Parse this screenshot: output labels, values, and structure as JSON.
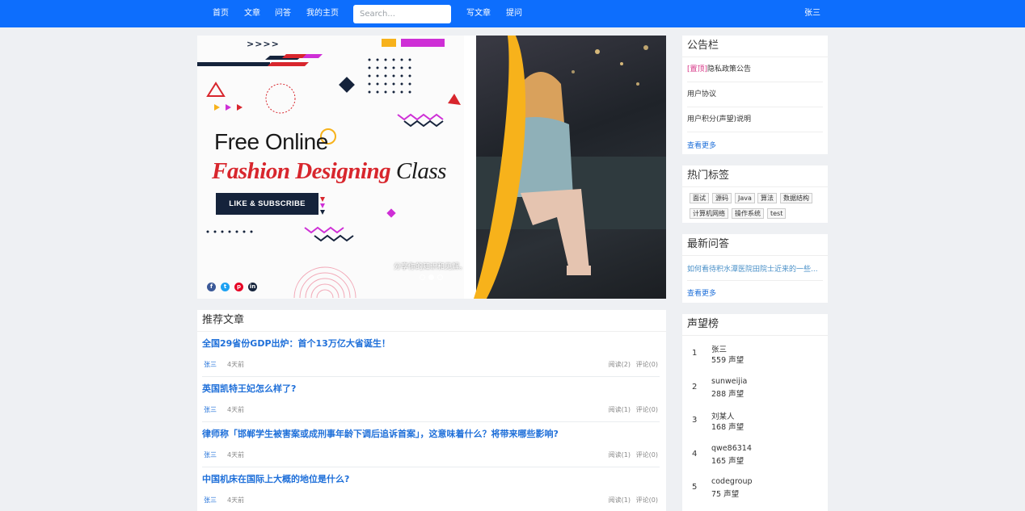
{
  "nav": {
    "items": [
      "首页",
      "文章",
      "问答",
      "我的主页"
    ],
    "search_placeholder": "Search...",
    "write_article": "写文章",
    "ask_question": "提问",
    "user": "张三"
  },
  "carousel": {
    "headline1": "Free Online",
    "headline2": "Fashion Designing",
    "headline2_tail": "Class",
    "cta": "LIKE & SUBSCRIBE",
    "arrows": ">>>>",
    "caption": "分享你的知识和见解。",
    "slides_count": 3,
    "active_slide_index": 1,
    "social_icons": [
      "facebook-icon",
      "twitter-icon",
      "pinterest-icon",
      "linkedin-icon"
    ],
    "colors": {
      "accent_yellow": "#f7b21b",
      "headline_red": "#d8262d",
      "cta_bg": "#15233b"
    }
  },
  "articles": {
    "title": "推荐文章",
    "items": [
      {
        "title": "全国29省份GDP出炉：首个13万亿大省诞生！",
        "author": "张三",
        "time": "4天前",
        "reads": "阅读(2)",
        "comments": "评论(0)"
      },
      {
        "title": "英国凯特王妃怎么样了?",
        "author": "张三",
        "time": "4天前",
        "reads": "阅读(1)",
        "comments": "评论(0)"
      },
      {
        "title": "律师称「邯郸学生被害案或成刑事年龄下调后追诉首案」，这意味着什么？将带来哪些影响?",
        "author": "张三",
        "time": "4天前",
        "reads": "阅读(1)",
        "comments": "评论(0)"
      },
      {
        "title": "中国机床在国际上大概的地位是什么?",
        "author": "张三",
        "time": "4天前",
        "reads": "阅读(1)",
        "comments": "评论(0)"
      }
    ]
  },
  "announcements": {
    "title": "公告栏",
    "pinned_label": "[置顶]",
    "items": [
      "隐私政策公告",
      "用户协议",
      "用户积分(声望)说明"
    ],
    "more": "查看更多"
  },
  "tags": {
    "title": "热门标签",
    "items": [
      "面试",
      "源码",
      "Java",
      "算法",
      "数据结构",
      "计算机网络",
      "操作系统",
      "test"
    ]
  },
  "qa": {
    "title": "最新问答",
    "items": [
      "如何看待积水潭医院田院士近来的一些..."
    ],
    "more": "查看更多"
  },
  "reputation": {
    "title": "声望榜",
    "items": [
      {
        "rank": "1",
        "name": "张三",
        "score": "559 声望"
      },
      {
        "rank": "2",
        "name": "sunweijia",
        "score": "288 声望"
      },
      {
        "rank": "3",
        "name": "刘某人",
        "score": "168 声望"
      },
      {
        "rank": "4",
        "name": "qwe86314",
        "score": "165 声望"
      },
      {
        "rank": "5",
        "name": "codegroup",
        "score": "75 声望"
      }
    ]
  },
  "theme": {
    "nav_bg": "#0d6efd",
    "link": "#1e6fd9",
    "page_bg": "#eef0f3"
  }
}
